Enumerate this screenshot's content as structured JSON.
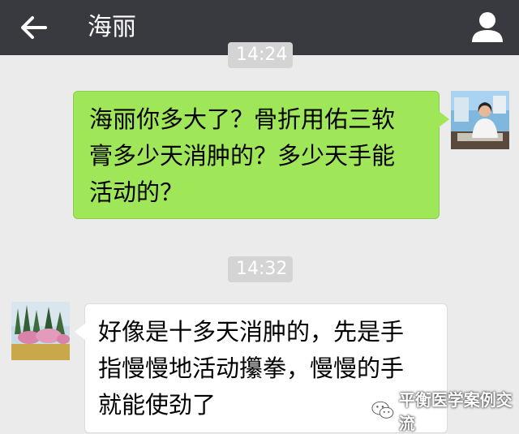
{
  "header": {
    "title": "海丽",
    "back_icon": "arrow-left-icon",
    "profile_icon": "person-icon"
  },
  "messages": [
    {
      "time": "14:24",
      "direction": "outgoing",
      "lines": [
        "海丽你多大了？骨折用佑三软",
        "膏多少天消肿的？多少天手能",
        "活动的？"
      ]
    },
    {
      "time": "14:32",
      "direction": "incoming",
      "lines": [
        "好像是十多天消肿的，先是手",
        "指慢慢地活动攥拳，慢慢的手",
        "就能使劲了"
      ]
    }
  ],
  "watermark": {
    "text": "平衡医学案例交流",
    "icon": "wechat-logo-icon"
  },
  "colors": {
    "topbar": "#393a3f",
    "background": "#ebebeb",
    "outgoing_bubble": "#9fe658",
    "incoming_bubble": "#ffffff",
    "timestamp_bg": "#d4d4d4"
  }
}
